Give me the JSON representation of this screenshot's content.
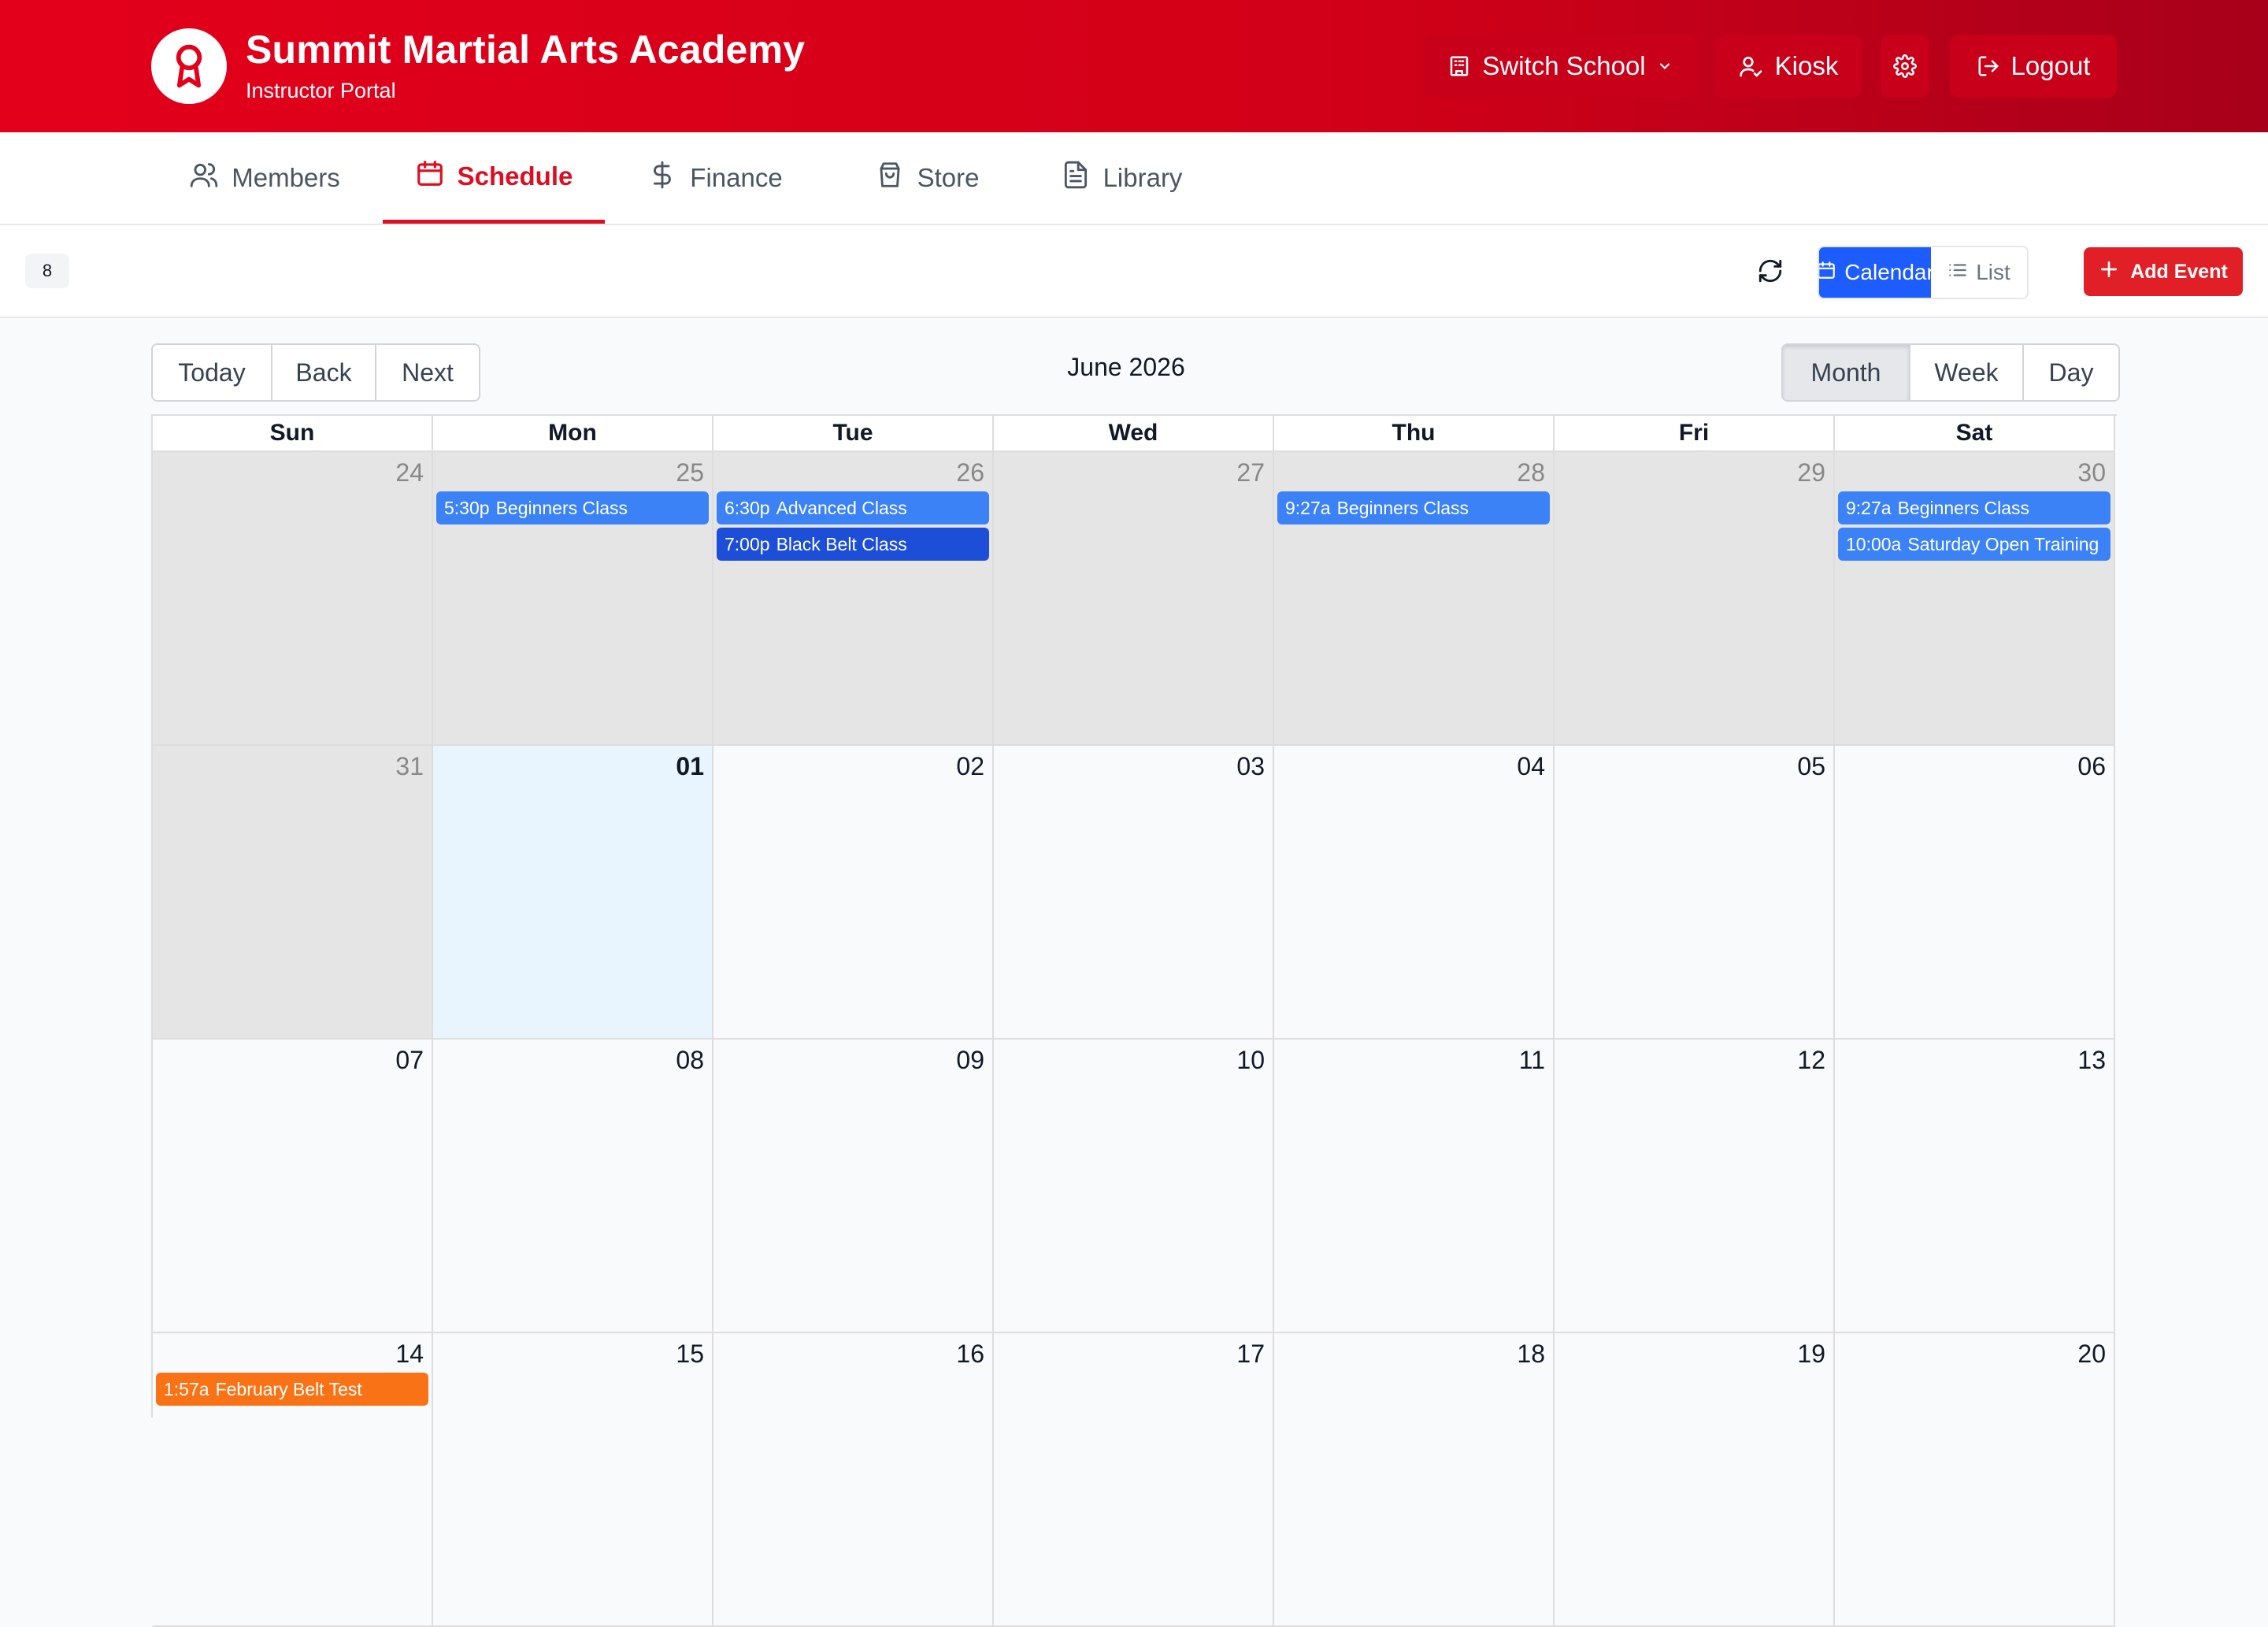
{
  "header": {
    "title": "Summit Martial Arts Academy",
    "subtitle": "Instructor Portal",
    "switch_school": "Switch School",
    "kiosk": "Kiosk",
    "logout": "Logout"
  },
  "nav": {
    "tabs": [
      {
        "label": "Members",
        "icon": "users-icon"
      },
      {
        "label": "Schedule",
        "icon": "calendar-icon",
        "active": true
      },
      {
        "label": "Finance",
        "icon": "dollar-icon"
      },
      {
        "label": "Store",
        "icon": "shopping-bag-icon"
      },
      {
        "label": "Library",
        "icon": "document-icon"
      }
    ]
  },
  "toolbar": {
    "count": "8",
    "calendar_label": "Calendar",
    "list_label": "List",
    "add_event": "Add Event"
  },
  "calendar": {
    "title": "June 2026",
    "nav": {
      "today": "Today",
      "back": "Back",
      "next": "Next"
    },
    "views": {
      "month": "Month",
      "week": "Week",
      "day": "Day",
      "selected": "Month"
    },
    "days_of_week": [
      "Sun",
      "Mon",
      "Tue",
      "Wed",
      "Thu",
      "Fri",
      "Sat"
    ],
    "weeks": [
      {
        "days": [
          {
            "num": "24",
            "off": true,
            "events": []
          },
          {
            "num": "25",
            "off": true,
            "events": [
              {
                "time": "5:30p",
                "title": "Beginners Class",
                "color": "#3b82f6"
              }
            ]
          },
          {
            "num": "26",
            "off": true,
            "events": [
              {
                "time": "6:30p",
                "title": "Advanced Class",
                "color": "#3b82f6"
              },
              {
                "time": "7:00p",
                "title": "Black Belt Class",
                "color": "#1d4ed8"
              }
            ]
          },
          {
            "num": "27",
            "off": true,
            "events": []
          },
          {
            "num": "28",
            "off": true,
            "events": [
              {
                "time": "9:27a",
                "title": "Beginners Class",
                "color": "#3b82f6"
              }
            ]
          },
          {
            "num": "29",
            "off": true,
            "events": []
          },
          {
            "num": "30",
            "off": true,
            "events": [
              {
                "time": "9:27a",
                "title": "Beginners Class",
                "color": "#3b82f6"
              },
              {
                "time": "10:00a",
                "title": "Saturday Open Training",
                "color": "#3b82f6"
              }
            ]
          }
        ]
      },
      {
        "days": [
          {
            "num": "31",
            "off": true,
            "events": []
          },
          {
            "num": "01",
            "today": true,
            "events": []
          },
          {
            "num": "02",
            "events": []
          },
          {
            "num": "03",
            "events": []
          },
          {
            "num": "04",
            "events": []
          },
          {
            "num": "05",
            "events": []
          },
          {
            "num": "06",
            "events": []
          }
        ]
      },
      {
        "days": [
          {
            "num": "07",
            "events": []
          },
          {
            "num": "08",
            "events": []
          },
          {
            "num": "09",
            "events": []
          },
          {
            "num": "10",
            "events": []
          },
          {
            "num": "11",
            "events": []
          },
          {
            "num": "12",
            "events": []
          },
          {
            "num": "13",
            "events": []
          }
        ]
      },
      {
        "days": [
          {
            "num": "14",
            "events": [
              {
                "time": "1:57a",
                "title": "February Belt Test",
                "color": "#f97316"
              }
            ]
          },
          {
            "num": "15",
            "events": []
          },
          {
            "num": "16",
            "events": []
          },
          {
            "num": "17",
            "events": []
          },
          {
            "num": "18",
            "events": []
          },
          {
            "num": "19",
            "events": []
          },
          {
            "num": "20",
            "events": []
          }
        ]
      }
    ]
  }
}
